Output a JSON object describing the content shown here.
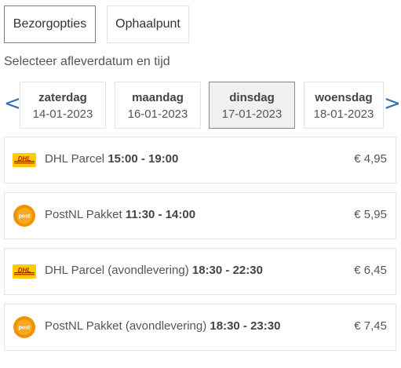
{
  "tabs": [
    {
      "label": "Bezorgopties",
      "active": true
    },
    {
      "label": "Ophaalpunt",
      "active": false
    }
  ],
  "subtitle": "Selecteer afleverdatum en tijd",
  "nav": {
    "prev_icon": "chevron-left-icon",
    "prev": "<",
    "next_icon": "chevron-right-icon",
    "next": ">"
  },
  "days": [
    {
      "name": "zaterdag",
      "date": "14-01-2023",
      "selected": false
    },
    {
      "name": "maandag",
      "date": "16-01-2023",
      "selected": false
    },
    {
      "name": "dinsdag",
      "date": "17-01-2023",
      "selected": true
    },
    {
      "name": "woensdag",
      "date": "18-01-2023",
      "selected": false
    }
  ],
  "options": [
    {
      "carrier": "dhl",
      "logo_icon": "dhl-logo-icon",
      "name": "DHL Parcel",
      "time": "15:00 - 19:00",
      "price": "€ 4,95"
    },
    {
      "carrier": "postnl",
      "logo_icon": "postnl-logo-icon",
      "name": "PostNL Pakket",
      "time": "11:30 - 14:00",
      "price": "€ 5,95"
    },
    {
      "carrier": "dhl",
      "logo_icon": "dhl-logo-icon",
      "name": "DHL Parcel (avondlevering)",
      "time": "18:30 - 22:30",
      "price": "€ 6,45"
    },
    {
      "carrier": "postnl",
      "logo_icon": "postnl-logo-icon",
      "name": "PostNL Pakket (avondlevering)",
      "time": "18:30 - 23:30",
      "price": "€ 7,45"
    }
  ],
  "logos": {
    "dhl_text": "DHL",
    "postnl_text": "post"
  },
  "colors": {
    "accent": "#2f6fb3",
    "dhl_yellow": "#ffcc00",
    "dhl_red": "#d40511",
    "postnl_orange": "#f39200"
  }
}
